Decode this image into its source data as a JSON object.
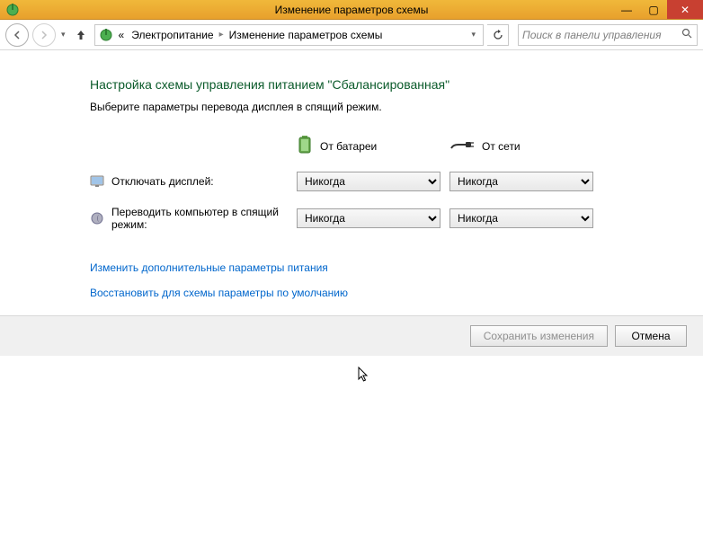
{
  "window": {
    "title": "Изменение параметров схемы",
    "controls": {
      "min": "—",
      "max": "▢",
      "close": "✕"
    }
  },
  "toolbar": {
    "breadcrumb": {
      "root_marker": "«",
      "items": [
        "Электропитание",
        "Изменение параметров схемы"
      ]
    },
    "search_placeholder": "Поиск в панели управления"
  },
  "page": {
    "heading": "Настройка схемы управления питанием \"Сбалансированная\"",
    "subtext": "Выберите параметры перевода дисплея в спящий режим.",
    "columns": {
      "battery": "От батареи",
      "plugged": "От сети"
    },
    "rows": {
      "display_off": {
        "label": "Отключать дисплей:",
        "battery_value": "Никогда",
        "plugged_value": "Никогда"
      },
      "sleep": {
        "label": "Переводить компьютер в спящий режим:",
        "battery_value": "Никогда",
        "plugged_value": "Никогда"
      }
    },
    "links": {
      "advanced": "Изменить дополнительные параметры питания",
      "restore": "Восстановить для схемы параметры по умолчанию"
    },
    "buttons": {
      "save": "Сохранить изменения",
      "cancel": "Отмена"
    }
  }
}
